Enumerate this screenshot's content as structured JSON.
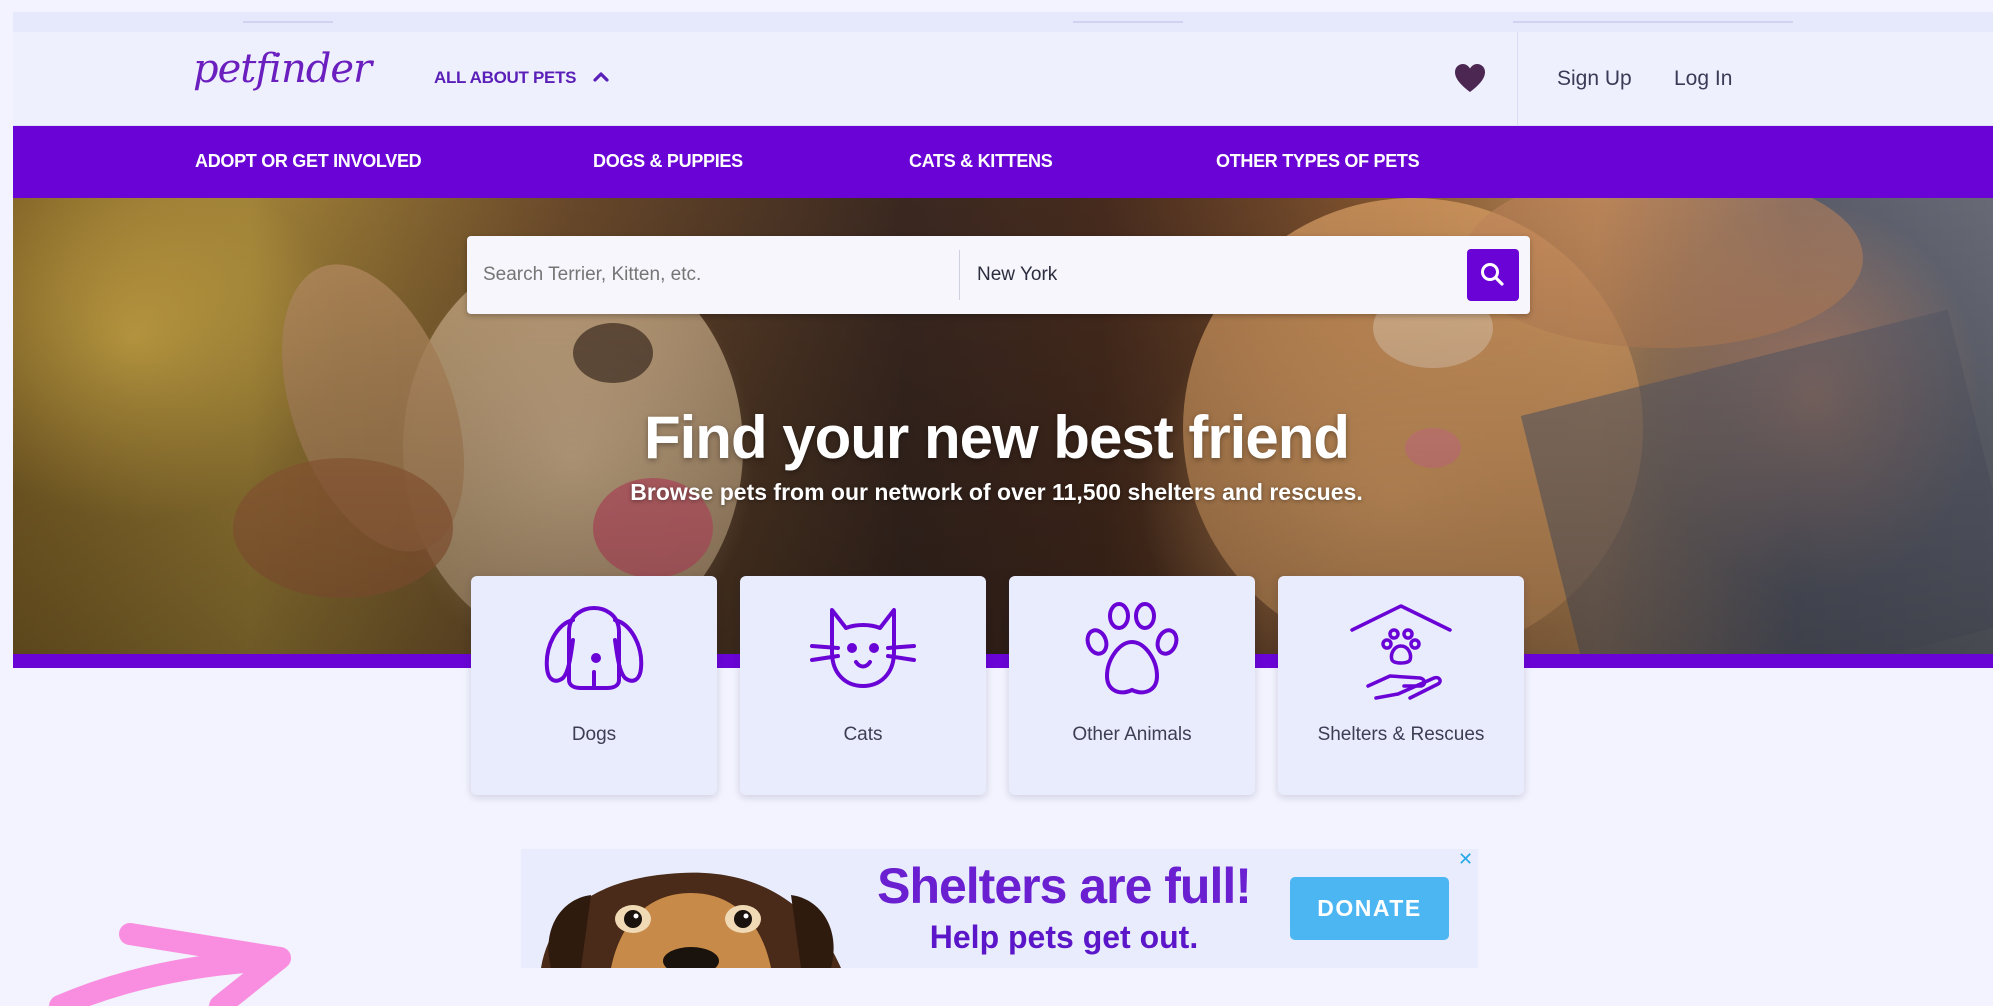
{
  "header": {
    "logo": "petfinder",
    "about_label": "ALL ABOUT PETS",
    "favorites_icon": "heart-icon",
    "signup_label": "Sign Up",
    "login_label": "Log In"
  },
  "nav": {
    "items": [
      {
        "label": "ADOPT OR GET INVOLVED"
      },
      {
        "label": "DOGS & PUPPIES"
      },
      {
        "label": "CATS & KITTENS"
      },
      {
        "label": "OTHER TYPES OF PETS"
      }
    ]
  },
  "search": {
    "pet_placeholder": "Search Terrier, Kitten, etc.",
    "location_value": "New York",
    "button_icon": "search-icon"
  },
  "hero": {
    "title": "Find your new best friend",
    "subtitle": "Browse pets from our network of over 11,500 shelters and rescues."
  },
  "categories": [
    {
      "label": "Dogs",
      "icon": "dog-icon"
    },
    {
      "label": "Cats",
      "icon": "cat-icon"
    },
    {
      "label": "Other Animals",
      "icon": "paw-icon"
    },
    {
      "label": "Shelters & Rescues",
      "icon": "shelter-icon"
    }
  ],
  "ad": {
    "title": "Shelters are full!",
    "subtitle": "Help pets get out.",
    "donate_label": "DONATE",
    "close_glyph": "✕"
  },
  "colors": {
    "brand_purple": "#6a04d6",
    "donate_blue": "#4cb6f3",
    "annotation_pink": "#f98ee0"
  }
}
